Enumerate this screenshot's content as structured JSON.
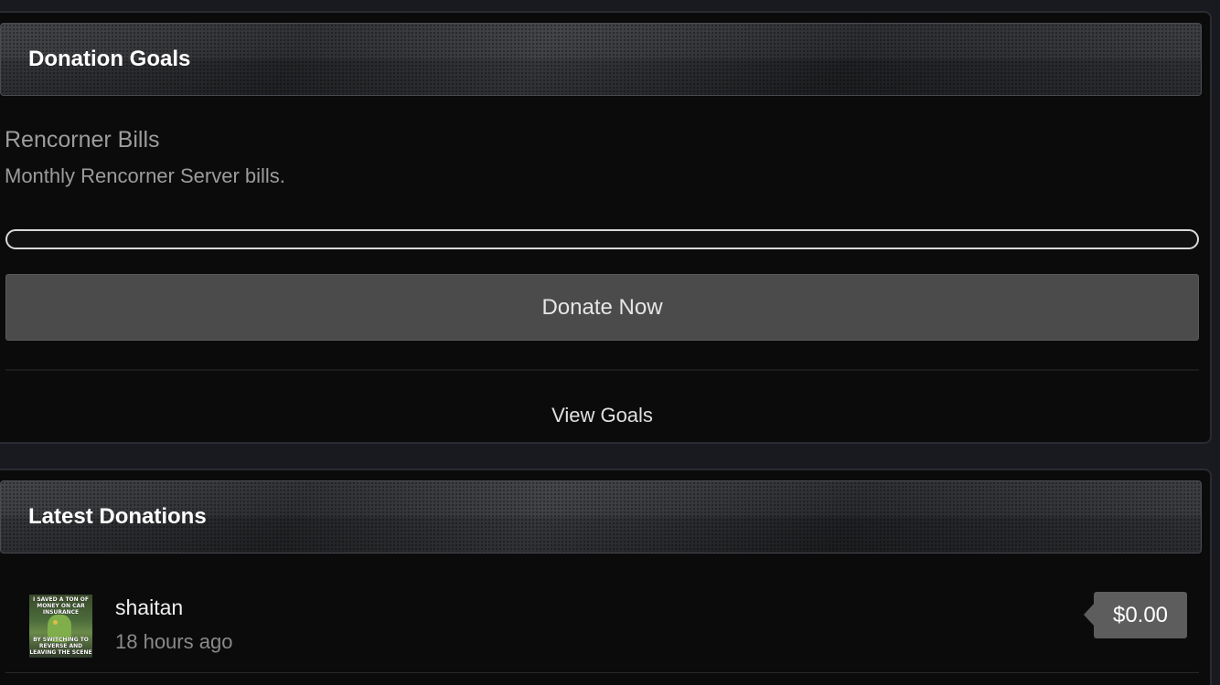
{
  "donation_goals": {
    "title": "Donation Goals",
    "goal": {
      "name": "Rencorner Bills",
      "description": "Monthly Rencorner Server bills.",
      "progress": 0
    },
    "donate_button": "Donate Now",
    "view_goals_link": "View Goals"
  },
  "latest_donations": {
    "title": "Latest Donations",
    "items": [
      {
        "avatar_caption_top": "I SAVED A TON OF MONEY ON CAR INSURANCE",
        "avatar_caption_bottom": "BY SWITCHING TO REVERSE AND LEAVING THE SCENE",
        "donor": "shaitan",
        "time": "18 hours ago",
        "amount": "$0.00"
      }
    ]
  }
}
